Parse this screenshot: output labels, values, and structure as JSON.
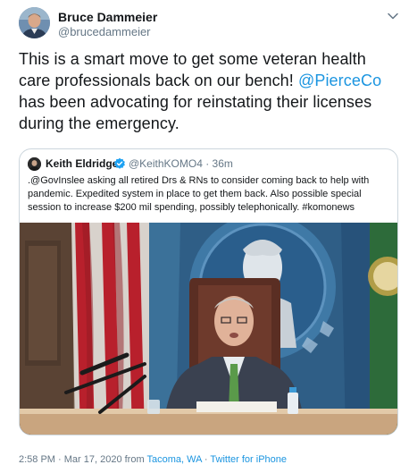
{
  "author": {
    "name": "Bruce Dammeier",
    "handle": "@brucedammeier"
  },
  "tweet": {
    "text_before": "This is a smart move to get some veteran health care professionals back on our bench!  ",
    "mention": "@PierceCo",
    "text_after": " has been advocating for reinstating their licenses during the emergency."
  },
  "quote": {
    "name": "Keith Eldridge",
    "handle_time": "@KeithKOMO4 · 36m",
    "text": ".@GovInslee asking all retired Drs & RNs to consider coming back to help with pandemic. Expedited system in place to get them back. Also possible special session to increase $200 mil spending, possibly telephonically. #komonews"
  },
  "meta": {
    "timestamp": "2:58 PM · Mar 17, 2020 from ",
    "location": "Tacoma, WA",
    "separator": " · ",
    "source": "Twitter for iPhone"
  },
  "icons": {
    "chevron": "chevron-down-icon",
    "verified": "verified-badge-icon"
  },
  "colors": {
    "link": "#1b95e0",
    "secondary_text": "#657786",
    "border": "#ccd6dd",
    "verified": "#1da1f2"
  }
}
